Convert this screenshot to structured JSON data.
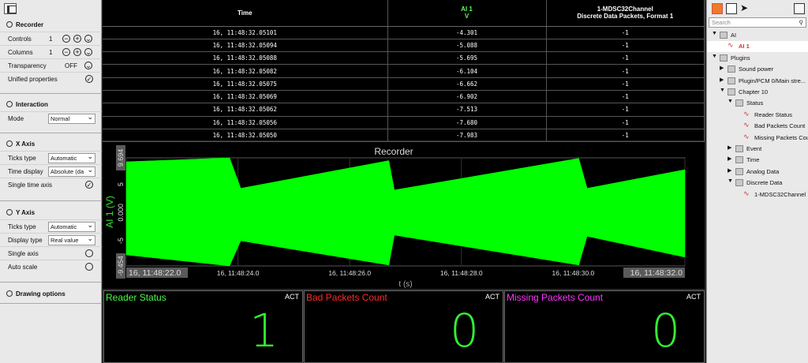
{
  "left_panel": {
    "recorder": {
      "title": "Recorder",
      "controls_label": "Controls",
      "controls_value": "1",
      "columns_label": "Columns",
      "columns_value": "1",
      "transparency_label": "Transparency",
      "transparency_value": "OFF",
      "unified_label": "Unified properties"
    },
    "interaction": {
      "title": "Interaction",
      "mode_label": "Mode",
      "mode_value": "Normal"
    },
    "x_axis": {
      "title": "X Axis",
      "ticks_label": "Ticks type",
      "ticks_value": "Automatic",
      "time_label": "Time display",
      "time_value": "Absolute (da",
      "single_label": "Single time axis"
    },
    "y_axis": {
      "title": "Y Axis",
      "ticks_label": "Ticks type",
      "ticks_value": "Automatic",
      "display_label": "Display type",
      "display_value": "Real value",
      "single_label": "Single axis",
      "auto_label": "Auto scale"
    },
    "drawing": {
      "title": "Drawing options"
    }
  },
  "table": {
    "col_time": "Time",
    "col_ai_name": "AI 1",
    "col_ai_unit": "V",
    "col_ch_name": "1-MDSC32Channel",
    "col_ch_sub": "Discrete Data Packets, Format 1",
    "rows": [
      {
        "time": "16, 11:48:32.05101",
        "ai": "-4.301",
        "ch": "-1"
      },
      {
        "time": "16, 11:48:32.05094",
        "ai": "-5.088",
        "ch": "-1"
      },
      {
        "time": "16, 11:48:32.05088",
        "ai": "-5.695",
        "ch": "-1"
      },
      {
        "time": "16, 11:48:32.05082",
        "ai": "-6.104",
        "ch": "-1"
      },
      {
        "time": "16, 11:48:32.05075",
        "ai": "-6.662",
        "ch": "-1"
      },
      {
        "time": "16, 11:48:32.05069",
        "ai": "-6.902",
        "ch": "-1"
      },
      {
        "time": "16, 11:48:32.05062",
        "ai": "-7.513",
        "ch": "-1"
      },
      {
        "time": "16, 11:48:32.05056",
        "ai": "-7.680",
        "ch": "-1"
      },
      {
        "time": "16, 11:48:32.05050",
        "ai": "-7.983",
        "ch": "-1"
      }
    ]
  },
  "chart_data": {
    "type": "area",
    "title": "Recorder",
    "xlabel": "t (s)",
    "ylabel": "AI 1 (V)",
    "y_ticks": [
      "9.694",
      "5",
      "0.000",
      "-5",
      "-9.454"
    ],
    "x_ticks": [
      "16, 11:48:22.0",
      "16, 11:48:24.0",
      "16, 11:48:26.0",
      "16, 11:48:28.0",
      "16, 11:48:30.0",
      "16, 11:48:32.0"
    ],
    "ylim": [
      -9.454,
      9.694
    ],
    "xlim_seconds": [
      22.0,
      32.0
    ],
    "series": [
      {
        "upper": [
          [
            22.0,
            9.0
          ],
          [
            23.85,
            9.69
          ],
          [
            24.05,
            4.3
          ],
          [
            26.7,
            9.2
          ],
          [
            26.8,
            4.0
          ],
          [
            30.1,
            9.6
          ],
          [
            30.25,
            4.3
          ],
          [
            32.0,
            7.6
          ]
        ],
        "lower": [
          [
            22.0,
            -7.5
          ],
          [
            23.85,
            -9.45
          ],
          [
            24.05,
            -5.0
          ],
          [
            26.7,
            -9.3
          ],
          [
            26.8,
            -4.0
          ],
          [
            30.1,
            -9.3
          ],
          [
            30.25,
            -4.2
          ],
          [
            32.0,
            -7.9
          ]
        ],
        "color": "#00ff00"
      }
    ],
    "grid": true
  },
  "status": [
    {
      "title": "Reader Status",
      "color": "#44ff44",
      "act": "ACT",
      "value": "1"
    },
    {
      "title": "Bad Packets Count",
      "color": "#ff2a2a",
      "act": "ACT",
      "value": "0"
    },
    {
      "title": "Missing Packets Count",
      "color": "#ff33ff",
      "act": "ACT",
      "value": "0"
    }
  ],
  "right_panel": {
    "search_placeholder": "Search",
    "tree": [
      {
        "label": "AI",
        "indent": 0,
        "kind": "folder",
        "open": true
      },
      {
        "label": "AI 1",
        "indent": 1,
        "kind": "signal",
        "selected": true
      },
      {
        "label": "Plugins",
        "indent": 0,
        "kind": "folder",
        "open": true
      },
      {
        "label": "Sound power",
        "indent": 1,
        "kind": "folder",
        "open": false
      },
      {
        "label": "Plugin/PCM 0/Main stre...",
        "indent": 1,
        "kind": "folder",
        "open": false
      },
      {
        "label": "Chapter 10",
        "indent": 1,
        "kind": "folder",
        "open": true
      },
      {
        "label": "Status",
        "indent": 2,
        "kind": "folder",
        "open": true
      },
      {
        "label": "Reader Status",
        "indent": 3,
        "kind": "signal"
      },
      {
        "label": "Bad Packets Count",
        "indent": 3,
        "kind": "signal"
      },
      {
        "label": "Missing Packets Count",
        "indent": 3,
        "kind": "signal"
      },
      {
        "label": "Event",
        "indent": 2,
        "kind": "folder",
        "open": false
      },
      {
        "label": "Time",
        "indent": 2,
        "kind": "folder",
        "open": false
      },
      {
        "label": "Analog Data",
        "indent": 2,
        "kind": "folder",
        "open": false
      },
      {
        "label": "Discrete Data",
        "indent": 2,
        "kind": "folder",
        "open": true
      },
      {
        "label": "1-MDSC32Channel",
        "indent": 3,
        "kind": "signal"
      }
    ]
  }
}
